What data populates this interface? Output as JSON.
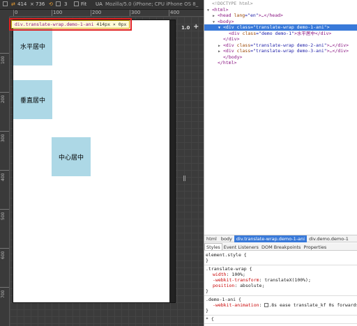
{
  "toolbar": {
    "width": "414",
    "times": "×",
    "height": "736",
    "count": "3",
    "fit_label": "Fit",
    "ua_label": "UA",
    "ua_value": "Mozilla/5.0 (iPhone; CPU iPhone OS 8_"
  },
  "ruler": {
    "top_labels": [
      "0",
      "100",
      "200",
      "300",
      "400"
    ],
    "left_labels": [
      "100",
      "200",
      "300",
      "400",
      "500",
      "600",
      "700"
    ]
  },
  "emulator": {
    "zoom": "1.0",
    "zoom_plus": "+",
    "tooltip_selector": "div.translate-wrap.demo-1-ani",
    "tooltip_size": "414px × 0px",
    "boxes": [
      {
        "label": "水平居中"
      },
      {
        "label": "垂直居中"
      },
      {
        "label": "中心居中"
      }
    ]
  },
  "dom_tree": [
    {
      "indent": 0,
      "tri": "",
      "html": "comment",
      "text": "<!DOCTYPE html>"
    },
    {
      "indent": 0,
      "tri": "▼",
      "text_tag": "<html>"
    },
    {
      "indent": 1,
      "tri": "▶",
      "text_tag": "<head",
      "attr": " lang",
      "val": "=\"en\"",
      "tail": ">…</head>"
    },
    {
      "indent": 1,
      "tri": "▼",
      "text_tag": "<body>"
    },
    {
      "indent": 2,
      "tri": "▼",
      "text_tag": "<div",
      "attr": " class",
      "val": "=\"translate-wrap demo-1-ani\"",
      "tail": ">",
      "selected": true
    },
    {
      "indent": 3,
      "tri": "",
      "text_tag": "<div",
      "attr": " class",
      "val": "=\"demo demo-1\"",
      "tail": ">水平居中</div>"
    },
    {
      "indent": 2,
      "tri": "",
      "text_tag": "</div>"
    },
    {
      "indent": 2,
      "tri": "▶",
      "text_tag": "<div",
      "attr": " class",
      "val": "=\"translate-wrap demo-2-ani\"",
      "tail": ">…</div>"
    },
    {
      "indent": 2,
      "tri": "▶",
      "text_tag": "<div",
      "attr": " class",
      "val": "=\"translate-wrap demo-3-ani\"",
      "tail": ">…</div>"
    },
    {
      "indent": 2,
      "tri": "",
      "text_tag": "</body>"
    },
    {
      "indent": 1,
      "tri": "",
      "text_tag": "</html>"
    }
  ],
  "breadcrumb": [
    "html",
    "body",
    "div.translate-wrap.demo-1-ani",
    "div.demo.demo-1"
  ],
  "breadcrumb_active": 2,
  "styles_tabs": [
    "Styles",
    "Event Listeners",
    "DOM Breakpoints",
    "Properties"
  ],
  "styles": {
    "element_style": "element.style {",
    "close": "}",
    "rule1_selector": ".translate-wrap {",
    "rule1_props": [
      {
        "name": "width",
        "value": "100%;"
      },
      {
        "name": "-webkit-transform",
        "value": "translateX(100%);"
      },
      {
        "name": "position",
        "value": "absolute;"
      }
    ],
    "rule2_selector": ".demo-1-ani {",
    "rule2_prop_name": "-webkit-animation",
    "rule2_prop_value": ".8s ease translate_kf 0s forwards;",
    "rule3_selector": "* {"
  }
}
